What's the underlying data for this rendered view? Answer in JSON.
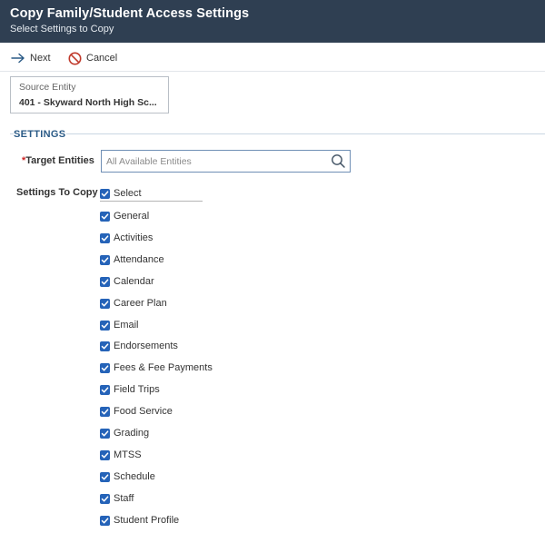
{
  "header": {
    "title": "Copy Family/Student Access Settings",
    "subtitle": "Select Settings to Copy"
  },
  "toolbar": {
    "next_label": "Next",
    "cancel_label": "Cancel"
  },
  "source": {
    "label": "Source Entity",
    "value": "401 - Skyward North High Sc..."
  },
  "settings_section": {
    "title": "SETTINGS",
    "target_label": "Target Entities",
    "required_mark": "*",
    "target_placeholder": "All Available Entities",
    "settings_label": "Settings To Copy",
    "select_all_label": "Select",
    "options": [
      {
        "label": "General",
        "checked": true
      },
      {
        "label": "Activities",
        "checked": true
      },
      {
        "label": "Attendance",
        "checked": true
      },
      {
        "label": "Calendar",
        "checked": true
      },
      {
        "label": "Career Plan",
        "checked": true
      },
      {
        "label": "Email",
        "checked": true
      },
      {
        "label": "Endorsements",
        "checked": true
      },
      {
        "label": "Fees & Fee Payments",
        "checked": true
      },
      {
        "label": "Field Trips",
        "checked": true
      },
      {
        "label": "Food Service",
        "checked": true
      },
      {
        "label": "Grading",
        "checked": true
      },
      {
        "label": "MTSS",
        "checked": true
      },
      {
        "label": "Schedule",
        "checked": true
      },
      {
        "label": "Staff",
        "checked": true
      },
      {
        "label": "Student Profile",
        "checked": true
      }
    ]
  },
  "colors": {
    "header_bg": "#2f3f52",
    "accent": "#2a5a86",
    "checkbox": "#2563b8",
    "cancel_icon": "#c0392b"
  }
}
